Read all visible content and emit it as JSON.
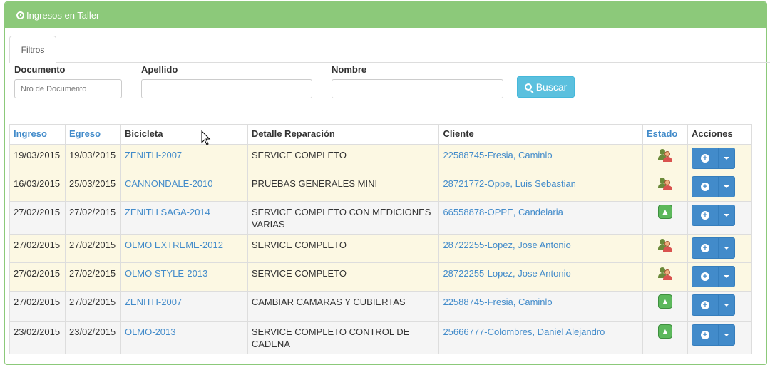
{
  "panel": {
    "title": "Ingresos en Taller"
  },
  "tabs": [
    {
      "label": "Filtros"
    }
  ],
  "filters": {
    "documento": {
      "label": "Documento",
      "placeholder": "Nro de Documento",
      "value": ""
    },
    "apellido": {
      "label": "Apellido",
      "placeholder": "",
      "value": ""
    },
    "nombre": {
      "label": "Nombre",
      "placeholder": "",
      "value": ""
    },
    "search_button": "Buscar"
  },
  "table": {
    "headers": [
      "Ingreso",
      "Egreso",
      "Bicicleta",
      "Detalle Reparación",
      "Cliente",
      "Estado",
      "Acciones"
    ],
    "rows": [
      {
        "ingreso": "19/03/2015",
        "egreso": "19/03/2015",
        "bicicleta": "ZENITH-2007",
        "detalle": "SERVICE COMPLETO",
        "cliente": "22588745-Fresia, Caminlo",
        "estado": "user-icon",
        "style": "warn"
      },
      {
        "ingreso": "16/03/2015",
        "egreso": "25/03/2015",
        "bicicleta": "CANNONDALE-2010",
        "detalle": "PRUEBAS GENERALES MINI",
        "cliente": "28721772-Oppe, Luis Sebastian",
        "estado": "user-icon",
        "style": "warn"
      },
      {
        "ingreso": "27/02/2015",
        "egreso": "27/02/2015",
        "bicicleta": "ZENITH SAGA-2014",
        "detalle": "SERVICE COMPLETO CON MEDICIONES VARIAS",
        "cliente": "66558878-OPPE, Candelaria",
        "estado": "thumbs-up-icon",
        "style": "plain"
      },
      {
        "ingreso": "27/02/2015",
        "egreso": "27/02/2015",
        "bicicleta": "OLMO EXTREME-2012",
        "detalle": "SERVICE COMPLETO",
        "cliente": "28722255-Lopez, Jose Antonio",
        "estado": "user-icon",
        "style": "warn"
      },
      {
        "ingreso": "27/02/2015",
        "egreso": "27/02/2015",
        "bicicleta": "OLMO STYLE-2013",
        "detalle": "SERVICE COMPLETO",
        "cliente": "28722255-Lopez, Jose Antonio",
        "estado": "user-icon",
        "style": "warn"
      },
      {
        "ingreso": "27/02/2015",
        "egreso": "27/02/2015",
        "bicicleta": "ZENITH-2007",
        "detalle": "CAMBIAR CAMARAS Y CUBIERTAS",
        "cliente": "22588745-Fresia, Caminlo",
        "estado": "thumbs-up-icon",
        "style": "plain"
      },
      {
        "ingreso": "23/02/2015",
        "egreso": "23/02/2015",
        "bicicleta": "OLMO-2013",
        "detalle": "SERVICE COMPLETO CONTROL DE CADENA",
        "cliente": "25666777-Colombres, Daniel Alejandro",
        "estado": "thumbs-up-icon",
        "style": "plain"
      }
    ]
  },
  "colors": {
    "panel_header": "#8cc97a",
    "link": "#428bca",
    "warning_row": "#fcf8e3",
    "info_button": "#5bc0de",
    "primary_button": "#428bca"
  }
}
